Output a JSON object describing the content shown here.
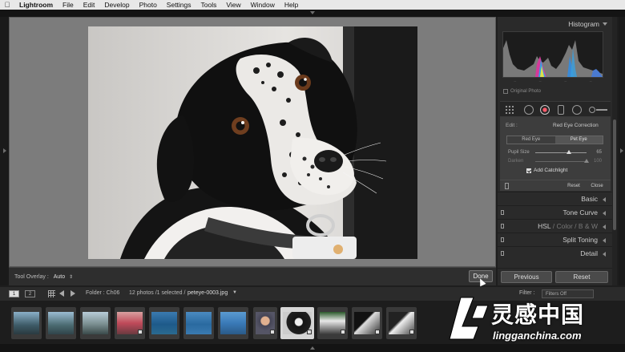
{
  "menubar": {
    "app": "Lightroom",
    "items": [
      "File",
      "Edit",
      "Develop",
      "Photo",
      "Settings",
      "Tools",
      "View",
      "Window",
      "Help"
    ]
  },
  "toolbar": {
    "overlay_label": "Tool Overlay :",
    "overlay_value": "Auto",
    "done_label": "Done"
  },
  "right_panel": {
    "histogram_title": "Histogram",
    "histogram_ticks": [
      "–",
      "–",
      "–",
      "–"
    ],
    "original_photo_label": "Original Photo",
    "red_eye": {
      "edit_label": "Edit :",
      "title": "Red Eye Correction",
      "modes": [
        "Red Eye",
        "Pet Eye"
      ],
      "selected_mode": "Pet Eye",
      "pupil_label": "Pupil Size",
      "pupil_value": "65",
      "pupil_fraction": 0.65,
      "darken_label": "Darken",
      "darken_value": "100",
      "darken_fraction": 1.0,
      "catchlight_label": "Add Catchlight",
      "reset_label": "Reset",
      "close_label": "Close"
    },
    "sections": {
      "basic": "Basic",
      "tone_curve": "Tone Curve",
      "hsl_1": "HSL",
      "hsl_sep": "/",
      "hsl_2": "Color",
      "hsl_3": "B & W",
      "split_toning": "Split Toning",
      "detail": "Detail"
    },
    "previous_label": "Previous",
    "reset_label": "Reset"
  },
  "filmstrip_bar": {
    "page1": "1",
    "page2": "2",
    "folder": "Folder : Ch06",
    "count": "12 photos /1 selected /",
    "filename": "peteye-0003.jpg",
    "filter_label": "Filter :",
    "filter_value": "Filters Off"
  },
  "watermark": {
    "chinese": "灵感中国",
    "url": "lingganchina.com"
  },
  "colors": {
    "accent_red": "#ff5a6a",
    "panel_bg": "#2a2a2a",
    "canvas_bg": "#7c7c7c"
  }
}
